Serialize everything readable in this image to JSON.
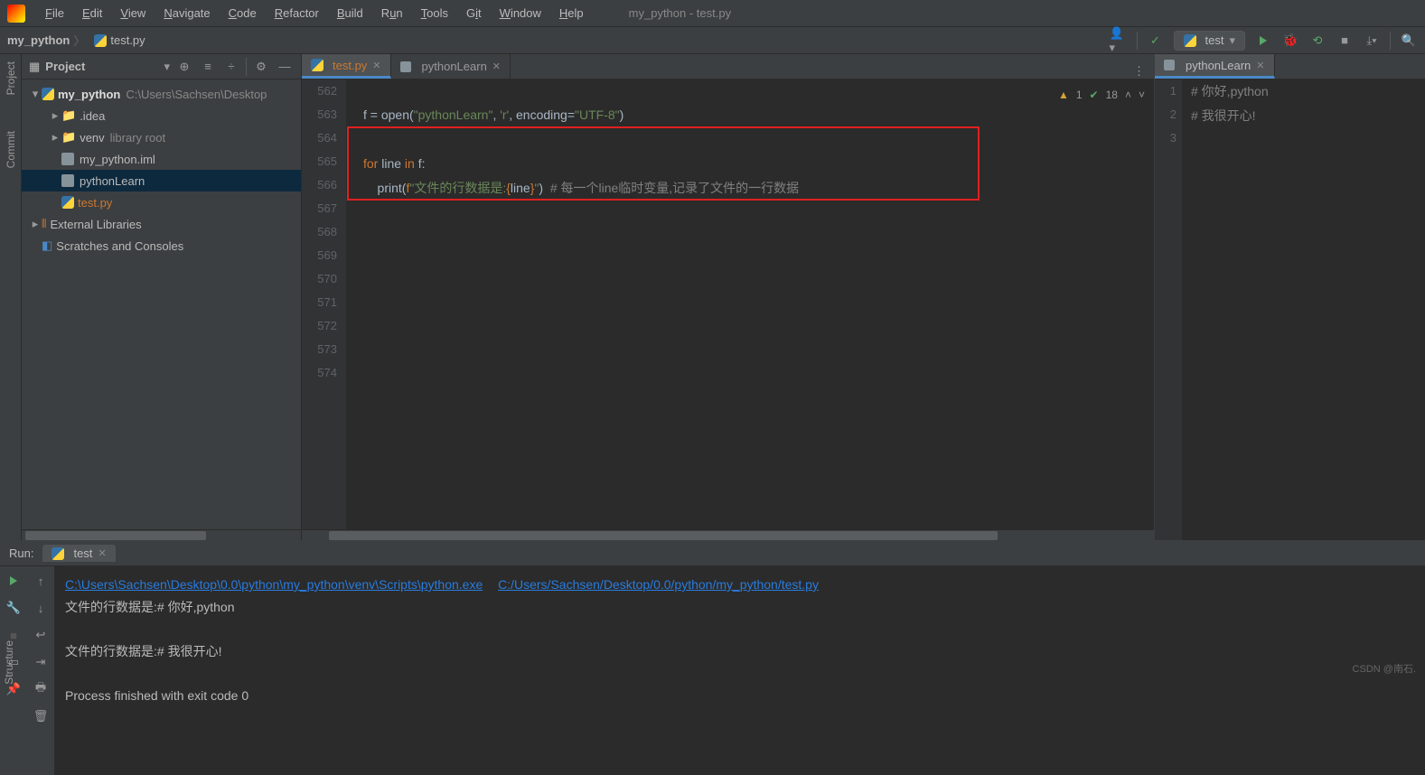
{
  "window_title": "my_python - test.py",
  "menubar": [
    "File",
    "Edit",
    "View",
    "Navigate",
    "Code",
    "Refactor",
    "Build",
    "Run",
    "Tools",
    "Git",
    "Window",
    "Help"
  ],
  "breadcrumb": {
    "root": "my_python",
    "file": "test.py"
  },
  "run_config": "test",
  "project_panel": {
    "title": "Project",
    "items": [
      {
        "label": "my_python",
        "path": "C:\\Users\\Sachsen\\Desktop",
        "bold": true,
        "indent": 0,
        "arrow": "▾",
        "icon": "folder"
      },
      {
        "label": ".idea",
        "indent": 1,
        "arrow": "▸",
        "icon": "folder"
      },
      {
        "label": "venv",
        "path": "library root",
        "indent": 1,
        "arrow": "▸",
        "icon": "folder"
      },
      {
        "label": "my_python.iml",
        "indent": 1,
        "icon": "file"
      },
      {
        "label": "pythonLearn",
        "indent": 1,
        "icon": "file",
        "selected": true
      },
      {
        "label": "test.py",
        "indent": 1,
        "icon": "py",
        "orange": true
      },
      {
        "label": "External Libraries",
        "indent": 0,
        "arrow": "▸",
        "icon": "lib"
      },
      {
        "label": "Scratches and Consoles",
        "indent": 0,
        "icon": "scratch"
      }
    ]
  },
  "editor_tabs": [
    {
      "label": "test.py",
      "active": true,
      "icon": "py"
    },
    {
      "label": "pythonLearn",
      "active": false,
      "icon": "file"
    }
  ],
  "gutter_lines": [
    "562",
    "563",
    "564",
    "565",
    "566",
    "567",
    "568",
    "569",
    "570",
    "571",
    "572",
    "573",
    "574"
  ],
  "code": {
    "line562": "f = open(\"pythonLearn\", 'r', encoding=\"UTF-8\")",
    "line564_for": "for",
    "line564_line": " line ",
    "line564_in": "in",
    "line564_f": " f:",
    "line565_print": "    print(",
    "line565_fpre": "f",
    "line565_str": "\"文件的行数据是:",
    "line565_brace_l": "{",
    "line565_var": "line",
    "line565_brace_r": "}",
    "line565_str2": "\"",
    "line565_close": ")  ",
    "line565_cmt": "# 每一个line临时变量,记录了文件的一行数据"
  },
  "inspections": {
    "warn": "1",
    "ok": "18"
  },
  "side_tab": "pythonLearn",
  "side_gutter": [
    "1",
    "2",
    "3"
  ],
  "side_code": {
    "l1": "# 你好,python",
    "l2": "# 我很开心!"
  },
  "left_tabs": [
    "Project",
    "Commit"
  ],
  "left_tab_bottom": "Structure",
  "run": {
    "label": "Run:",
    "tab": "test",
    "link1": "C:\\Users\\Sachsen\\Desktop\\0.0\\python\\my_python\\venv\\Scripts\\python.exe",
    "link2": "C:/Users/Sachsen/Desktop/0.0/python/my_python/test.py",
    "out1": "文件的行数据是:# 你好,python",
    "out2": "文件的行数据是:# 我很开心!",
    "exit": "Process finished with exit code 0"
  },
  "watermark": "CSDN @南石."
}
